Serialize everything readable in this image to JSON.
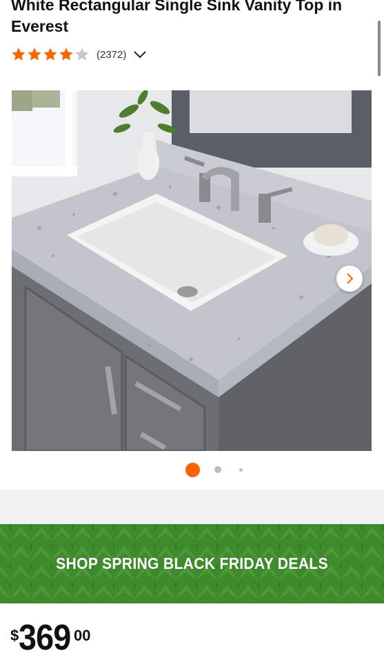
{
  "product": {
    "title": "White Rectangular Single Sink Vanity Top in Everest",
    "rating_value": 4,
    "rating_max": 5,
    "review_count": "(2372)"
  },
  "gallery": {
    "image_name": "vanity-sink-photo",
    "current_slide": 1,
    "slide_dots": 3
  },
  "promo": {
    "text": "SHOP SPRING BLACK FRIDAY DEALS"
  },
  "price": {
    "currency": "$",
    "dollars": "369",
    "cents": "00"
  },
  "colors": {
    "accent": "#f96302",
    "star_filled": "#f96302",
    "star_empty": "#c8c8c8",
    "promo_green": "#3f8a2c"
  },
  "icons": {
    "star": "star-icon",
    "expand": "chevron-down-icon",
    "next": "chevron-right-icon"
  }
}
